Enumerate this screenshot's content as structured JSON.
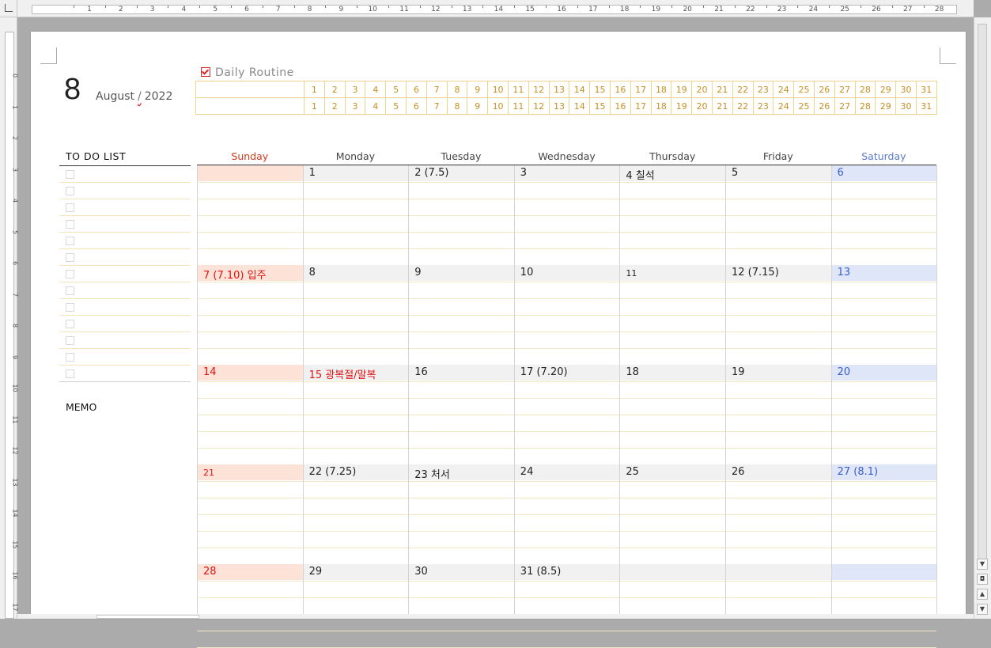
{
  "rulers": {
    "horizontal": [
      "1",
      "2",
      "3",
      "4",
      "5",
      "6",
      "7",
      "8",
      "9",
      "10",
      "11",
      "12",
      "13",
      "14",
      "15",
      "16",
      "17",
      "18",
      "19",
      "20",
      "21",
      "22",
      "23",
      "24",
      "25",
      "26",
      "27",
      "28"
    ],
    "vertical": [
      "0",
      "1",
      "2",
      "3",
      "4",
      "5",
      "6",
      "7",
      "8",
      "9",
      "10",
      "11",
      "12",
      "13",
      "14",
      "15",
      "16",
      "17"
    ]
  },
  "header": {
    "month_number": "8",
    "month_name": "August",
    "separator": "/",
    "year": "2022"
  },
  "routine": {
    "label": "Daily  Routine",
    "checked": true,
    "days": [
      "1",
      "2",
      "3",
      "4",
      "5",
      "6",
      "7",
      "8",
      "9",
      "10",
      "11",
      "12",
      "13",
      "14",
      "15",
      "16",
      "17",
      "18",
      "19",
      "20",
      "21",
      "22",
      "23",
      "24",
      "25",
      "26",
      "27",
      "28",
      "29",
      "30",
      "31"
    ]
  },
  "todo": {
    "title": "TO  DO  LIST",
    "item_count": 13
  },
  "memo": {
    "title": "MEMO"
  },
  "calendar": {
    "weekdays": [
      "Sunday",
      "Monday",
      "Tuesday",
      "Wednesday",
      "Thursday",
      "Friday",
      "Saturday"
    ],
    "weeks": [
      [
        "",
        "1",
        "2  (7.5)",
        "3",
        "4 칠석",
        "5",
        "6"
      ],
      [
        "7  (7.10)  입주",
        "8",
        "9",
        "10",
        "11",
        "12  (7.15)",
        "13"
      ],
      [
        "14",
        "15  광복절/말복",
        "16",
        "17  (7.20)",
        "18",
        "19",
        "20"
      ],
      [
        "21",
        "22  (7.25)",
        "23  처서",
        "24",
        "25",
        "26",
        "27  (8.1)"
      ],
      [
        "28",
        "29",
        "30",
        "31  (8.5)",
        "",
        "",
        ""
      ]
    ],
    "holidays": [
      "15  광복절/말복"
    ],
    "small_cells": [
      "11",
      "21"
    ]
  },
  "colors": {
    "sunday_text": "#d13b1b",
    "saturday_text": "#5a7bd0",
    "sunday_bg": "#fde3d7",
    "saturday_bg": "#dfe6f8",
    "weekday_bg": "#f1f1f1",
    "routine_gold": "#c79022",
    "routine_border": "#efd38a"
  }
}
